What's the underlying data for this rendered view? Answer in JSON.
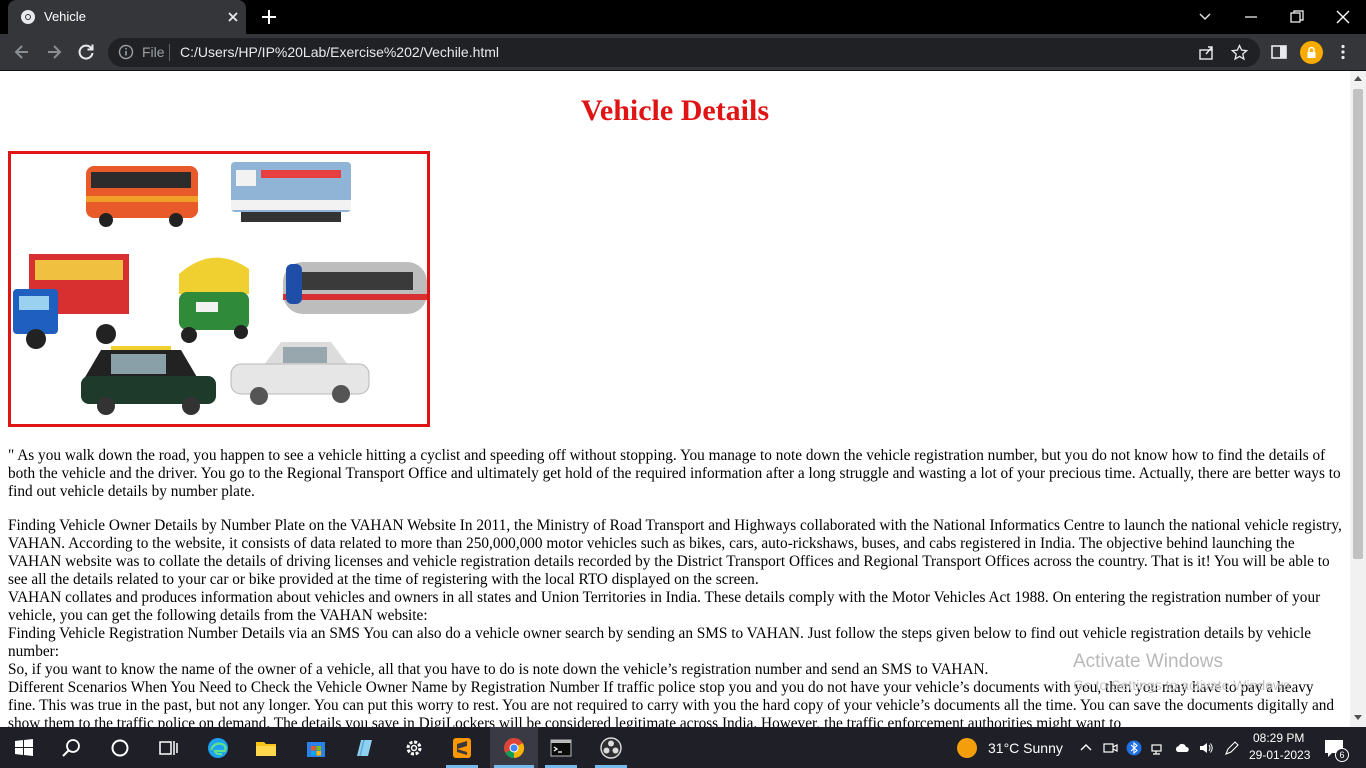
{
  "browser": {
    "tab_title": "Vehicle",
    "url_scheme_label": "File",
    "url": "C:/Users/HP/IP%20Lab/Exercise%202/Vechile.html"
  },
  "page": {
    "heading": "Vehicle Details",
    "image_alt": "Collection of toy vehicles: bus, train engine, truck, auto-rickshaw, metro train and two taxis",
    "paragraphs": [
      "\" As you walk down the road, you happen to see a vehicle hitting a cyclist and speeding off without stopping. You manage to note down the vehicle registration number, but you do not know how to find the details of both the vehicle and the driver. You go to the Regional Transport Office and ultimately get hold of the required information after a long struggle and wasting a lot of your precious time. Actually, there are better ways to find out vehicle details by number plate."
    ],
    "lines": [
      "Finding Vehicle Owner Details by Number Plate on the VAHAN Website In 2011, the Ministry of Road Transport and Highways collaborated with the National Informatics Centre to launch the national vehicle registry, VAHAN. According to the website, it consists of data related to more than 250,000,000 motor vehicles such as bikes, cars, auto-rickshaws, buses, and cabs registered in India. The objective behind launching the VAHAN website was to collate the details of driving licenses and vehicle registration details recorded by the District Transport Offices and Regional Transport Offices across the country. That is it! You will be able to see all the details related to your car or bike provided at the time of registering with the local RTO displayed on the screen.",
      "VAHAN collates and produces information about vehicles and owners in all states and Union Territories in India. These details comply with the Motor Vehicles Act 1988. On entering the registration number of your vehicle, you can get the following details from the VAHAN website:",
      "Finding Vehicle Registration Number Details via an SMS You can also do a vehicle owner search by sending an SMS to VAHAN. Just follow the steps given below to find out vehicle registration details by vehicle number:",
      "So, if you want to know the name of the owner of a vehicle, all that you have to do is note down the vehicle’s registration number and send an SMS to VAHAN.",
      "Different Scenarios When You Need to Check the Vehicle Owner Name by Registration Number If traffic police stop you and you do not have your vehicle’s documents with you, then you may have to pay a heavy fine. This was true in the past, but not any longer. You can put this worry to rest. You are not required to carry with you the hard copy of your vehicle’s documents all the time. You can save the documents digitally and show them to the traffic police on demand. The details you save in DigiLockers will be considered legitimate across India. However, the traffic enforcement authorities might want to"
    ],
    "watermark_title": "Activate Windows",
    "watermark_sub": "Go to Settings to activate Windows."
  },
  "taskbar": {
    "weather": "31°C  Sunny",
    "time": "08:29 PM",
    "date": "29-01-2023",
    "notification_count": "6"
  },
  "colors": {
    "heading": "#e01414",
    "image_border": "#e01414",
    "titlebar": "#000000",
    "toolbar": "#35363a",
    "taskbar": "#1f1f27"
  },
  "icons": {
    "tab": "chrome-favicon-icon",
    "close": "close-icon",
    "new_tab": "plus-icon",
    "back": "back-arrow-icon",
    "forward": "forward-arrow-icon",
    "reload": "reload-icon",
    "info": "info-icon",
    "share": "share-icon",
    "bookmark": "star-icon",
    "side_panel": "side-panel-icon",
    "menu": "kebab-menu-icon"
  }
}
